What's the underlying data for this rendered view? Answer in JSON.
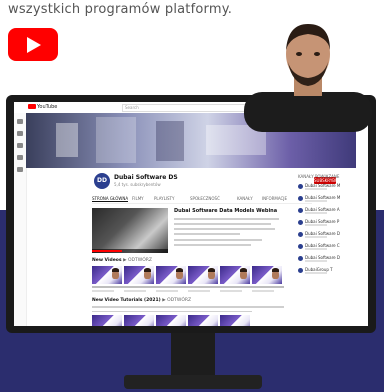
{
  "hero": {
    "text": "wszystkich programów platformy."
  },
  "youtube_screen": {
    "topbar": {
      "brand": "YouTube",
      "search_placeholder": "Search"
    },
    "channel": {
      "avatar_text": "DD",
      "name": "Dubai Software DS",
      "subscribers": "5,4 tys. subskrybentów",
      "subscribe_label": "SUBSKRYBUJ"
    },
    "tabs": [
      "STRONA GŁÓWNA",
      "FILMY",
      "PLAYLISTY",
      "SPOŁECZNOŚĆ",
      "KANAŁY",
      "INFORMACJE"
    ],
    "featured": {
      "title": "Dubai Software Data Models Webina"
    },
    "sections": {
      "first": "New Videos",
      "first_action": "▶ ODTWÓRZ",
      "second": "New Video Tutorials (2021)",
      "second_action": "▶ ODTWÓRZ"
    },
    "right_column": {
      "title": "KANAŁY POWIĄZANE",
      "items": [
        "Dubai Software M",
        "Dubai Software M",
        "Dubai Software A",
        "Dubai Software P",
        "Dubai Software D",
        "Dubai Software C",
        "Dubai Software D",
        "DubaiGroup T"
      ]
    }
  }
}
